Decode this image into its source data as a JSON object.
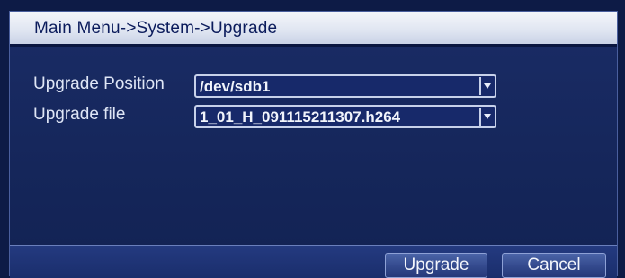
{
  "dialog": {
    "title": "Main Menu->System->Upgrade"
  },
  "fields": {
    "position": {
      "label": "Upgrade Position",
      "value": "/dev/sdb1"
    },
    "file": {
      "label": "Upgrade file",
      "value": "1_01_H_091115211307.h264"
    }
  },
  "buttons": {
    "upgrade": "Upgrade",
    "cancel": "Cancel"
  },
  "icons": {
    "dropdown": "chevron-down-icon"
  }
}
